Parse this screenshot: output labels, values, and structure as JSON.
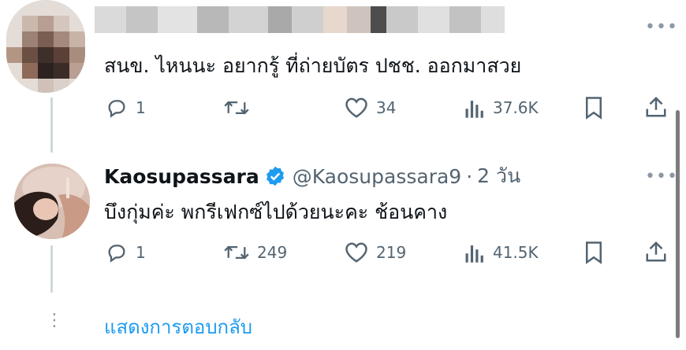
{
  "tweets": [
    {
      "author_blurred": true,
      "text": "สนข. ไหนนะ อยากรู้ ที่ถ่ายบัตร ปชช. ออกมาสวย",
      "more": "•••",
      "reply_count": "1",
      "retweet_count": "",
      "like_count": "34",
      "view_count": "37.6K"
    },
    {
      "author_blurred": false,
      "name": "Kaosupassara",
      "handle": "@Kaosupassara9",
      "dot": "·",
      "time": "2 วัน",
      "text": "บึงกุ่มค่ะ พกรีเฟกซ์ไปด้วยนะคะ ช้อนคาง",
      "more": "•••",
      "reply_count": "1",
      "retweet_count": "249",
      "like_count": "219",
      "view_count": "41.5K"
    }
  ],
  "show_replies": {
    "label": "แสดงการตอบกลับ",
    "dots": "⋮"
  },
  "colors": {
    "accent": "#1d9bf0",
    "secondary_text": "#536471",
    "verified": "#1d9bf0"
  },
  "icons": [
    "reply-icon",
    "retweet-icon",
    "like-icon",
    "views-icon",
    "bookmark-icon",
    "share-icon",
    "verified-badge-icon",
    "more-icon"
  ]
}
